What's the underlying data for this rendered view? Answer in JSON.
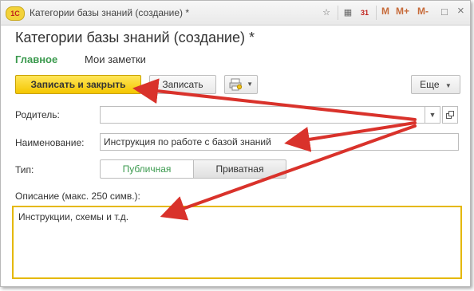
{
  "window": {
    "logo_text": "1С",
    "title": "Категории базы знаний (создание) *",
    "toolbar_m1": "M",
    "toolbar_m2": "M+",
    "toolbar_m3": "M-",
    "toolbar_cal": "31",
    "toolbar_min": "□",
    "toolbar_close": "×"
  },
  "form": {
    "title": "Категории базы знаний (создание) *",
    "tabs": [
      {
        "label": "Главное",
        "active": true
      },
      {
        "label": "Мои заметки",
        "active": false
      }
    ]
  },
  "toolbar": {
    "save_close_label": "Записать и закрыть",
    "save_label": "Записать",
    "more_label": "Еще"
  },
  "fields": {
    "parent_label": "Родитель:",
    "parent_value": "",
    "name_label": "Наименование:",
    "name_value": "Инструкция по работе с базой знаний",
    "type_label": "Тип:",
    "type_options": [
      "Публичная",
      "Приватная"
    ],
    "type_selected": "Публичная",
    "description_label": "Описание (макс. 250 симв.):",
    "description_value": "Инструкции, схемы и т.д."
  },
  "colors": {
    "accent_green": "#3b9a4e",
    "primary_button": "#f4c600",
    "highlight_border": "#e5b800",
    "arrow": "#d9322b"
  }
}
